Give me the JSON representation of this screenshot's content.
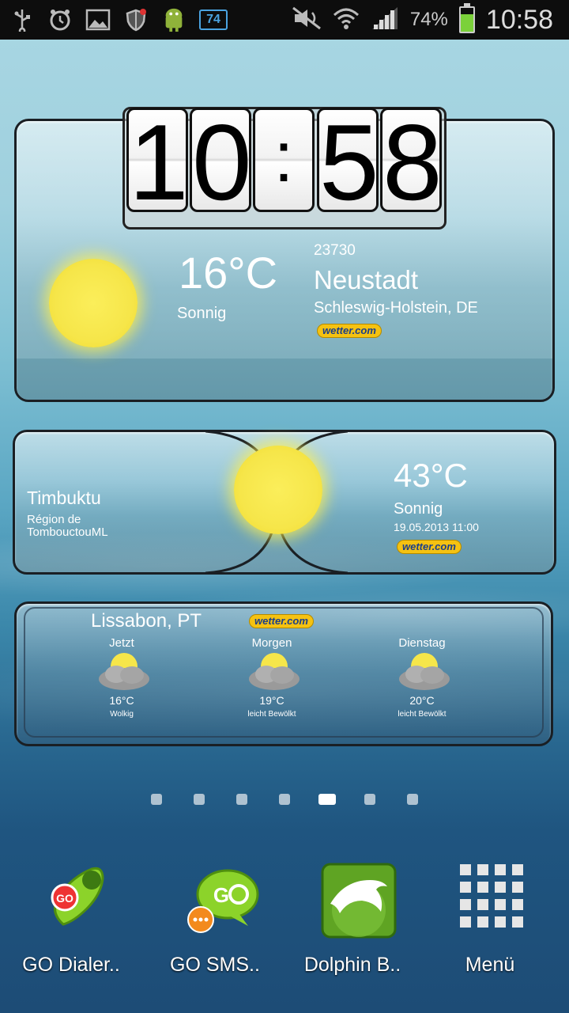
{
  "status_bar": {
    "battery_percent": "74%",
    "time": "10:58",
    "badge_number": "74",
    "icons_left": [
      "usb-icon",
      "alarm-icon",
      "gallery-icon",
      "shield-icon",
      "android-icon",
      "badge-icon"
    ],
    "icons_right": [
      "mute-icon",
      "wifi-icon",
      "signal-icon",
      "battery-icon"
    ]
  },
  "widget_main": {
    "clock": {
      "h1": "1",
      "h2": "0",
      "sep": ":",
      "m1": "5",
      "m2": "8"
    },
    "temperature": "16°C",
    "condition": "Sonnig",
    "postal_code": "23730",
    "city": "Neustadt",
    "region": "Schleswig-Holstein, DE",
    "brand": "wetter.com"
  },
  "widget_timbuktu": {
    "city": "Timbuktu",
    "region_line1": "Région de",
    "region_line2": "TombouctouML",
    "temperature": "43°C",
    "condition": "Sonnig",
    "datetime": "19.05.2013 11:00",
    "brand": "wetter.com"
  },
  "widget_lisbon": {
    "city": "Lissabon, PT",
    "brand": "wetter.com",
    "days": [
      {
        "label": "Jetzt",
        "temp": "16°C",
        "desc": "Wolkig"
      },
      {
        "label": "Morgen",
        "temp": "19°C",
        "desc": "leicht Bewölkt"
      },
      {
        "label": "Dienstag",
        "temp": "20°C",
        "desc": "leicht Bewölkt"
      }
    ]
  },
  "pager": {
    "count": 7,
    "active_index": 4
  },
  "dock": [
    {
      "label": "GO Dialer..",
      "icon": "go-dialer-icon"
    },
    {
      "label": "GO SMS..",
      "icon": "go-sms-icon"
    },
    {
      "label": "Dolphin B..",
      "icon": "dolphin-browser-icon"
    },
    {
      "label": "Menü",
      "icon": "app-menu-grid-icon"
    }
  ],
  "colors": {
    "brand_yellow": "#f5c211",
    "sun": "#f6e64a",
    "battery_green": "#7bd13a"
  }
}
